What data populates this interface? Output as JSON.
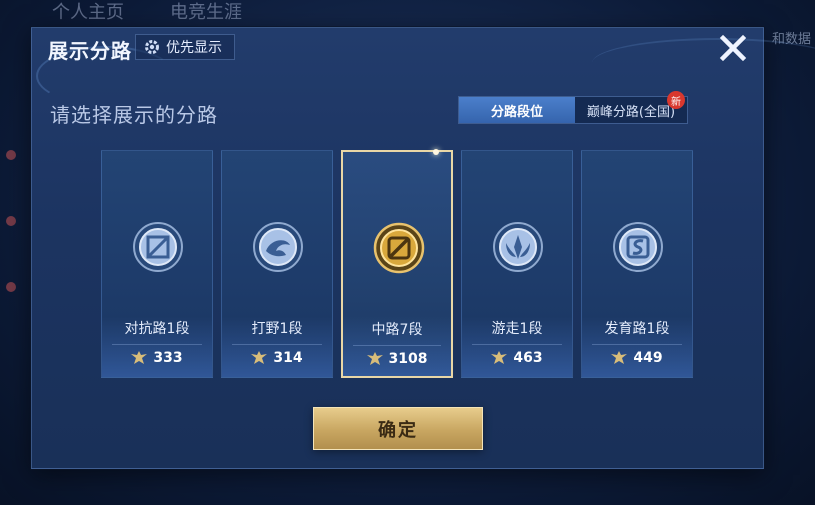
{
  "background": {
    "tabs": [
      "个人主页",
      "电竞生涯"
    ],
    "right_text": "和数据"
  },
  "dialog": {
    "title": "展示分路",
    "priority_label": "优先显示",
    "subtitle": "请选择展示的分路",
    "toggle": {
      "active": "分路段位",
      "inactive": "巅峰分路(全国)",
      "badge": "新"
    },
    "lanes": [
      {
        "name": "对抗路1段",
        "score": "333",
        "icon": "clash-lane-icon",
        "selected": false
      },
      {
        "name": "打野1段",
        "score": "314",
        "icon": "jungle-icon",
        "selected": false
      },
      {
        "name": "中路7段",
        "score": "3108",
        "icon": "mid-lane-icon",
        "selected": true
      },
      {
        "name": "游走1段",
        "score": "463",
        "icon": "roam-icon",
        "selected": false
      },
      {
        "name": "发育路1段",
        "score": "449",
        "icon": "farm-lane-icon",
        "selected": false
      }
    ],
    "confirm_label": "确定",
    "colors": {
      "accent_gold": "#c8a661",
      "active_tab": "#3f72bd",
      "panel": "#1c3461"
    }
  }
}
